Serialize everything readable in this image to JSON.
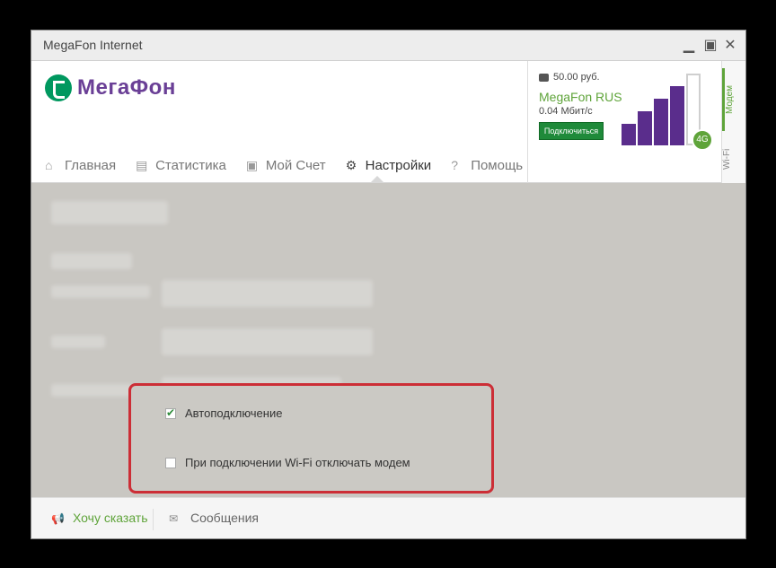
{
  "window": {
    "title": "MegaFon Internet"
  },
  "logo": {
    "text": "МегаФон"
  },
  "nav": {
    "items": [
      {
        "label": "Главная",
        "icon": "home-icon"
      },
      {
        "label": "Статистика",
        "icon": "stats-icon"
      },
      {
        "label": "Мой Счет",
        "icon": "wallet-icon"
      },
      {
        "label": "Настройки",
        "icon": "gear-icon",
        "active": true
      },
      {
        "label": "Помощь",
        "icon": "help-icon"
      }
    ]
  },
  "status": {
    "balance": "50.00 руб.",
    "operator": "MegaFon RUS",
    "speed": "0.04 Мбит/с",
    "connect_label": "Подключиться",
    "network": "4G",
    "signal_bars": 4,
    "signal_total": 5
  },
  "side_tabs": {
    "modem": "Модем",
    "wifi": "Wi-Fi"
  },
  "settings": {
    "autoconnect_label": "Автоподключение",
    "autoconnect_checked": true,
    "wifi_disable_label": "При подключении Wi-Fi отключать модем",
    "wifi_disable_checked": false
  },
  "footer": {
    "feedback": "Хочу сказать",
    "messages": "Сообщения"
  },
  "colors": {
    "brand_green": "#00985f",
    "brand_purple": "#6a3f96",
    "highlight_red": "#cc2e36"
  }
}
